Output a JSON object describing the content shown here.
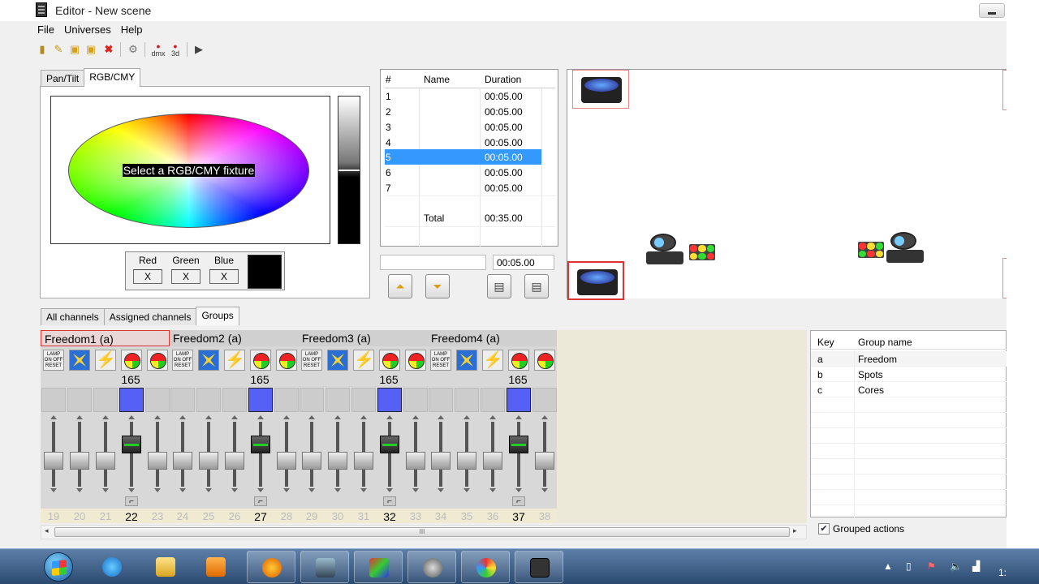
{
  "window": {
    "title": "Editor - New scene"
  },
  "menu": [
    "File",
    "Universes",
    "Help"
  ],
  "toolbar": {
    "dmx_label": "dmx",
    "threed_label": "3d"
  },
  "color_panel": {
    "tabs": [
      "Pan/Tilt",
      "RGB/CMY"
    ],
    "active_tab": "RGB/CMY",
    "wheel_message": "Select a RGB/CMY fixture",
    "rgb": {
      "labels": [
        "Red",
        "Green",
        "Blue"
      ],
      "values": [
        "X",
        "X",
        "X"
      ],
      "swatch_color": "#000000"
    }
  },
  "steps_table": {
    "headers": [
      "#",
      "Name",
      "Duration"
    ],
    "rows": [
      {
        "num": "1",
        "name": "",
        "duration": "00:05.00"
      },
      {
        "num": "2",
        "name": "",
        "duration": "00:05.00"
      },
      {
        "num": "3",
        "name": "",
        "duration": "00:05.00"
      },
      {
        "num": "4",
        "name": "",
        "duration": "00:05.00"
      },
      {
        "num": "5",
        "name": "",
        "duration": "00:05.00",
        "selected": true
      },
      {
        "num": "6",
        "name": "",
        "duration": "00:05.00"
      },
      {
        "num": "7",
        "name": "",
        "duration": "00:05.00"
      }
    ],
    "total_label": "Total",
    "total_value": "00:35.00",
    "name_input": "",
    "duration_input": "00:05.00"
  },
  "lower_tabs": [
    "All channels",
    "Assigned channels",
    "Groups"
  ],
  "active_lower_tab": "Groups",
  "fixtures": [
    {
      "name": "Freedom1 (a)",
      "value": "165",
      "channels": [
        "19",
        "20",
        "21",
        "22",
        "23"
      ],
      "active": "22",
      "selected": true
    },
    {
      "name": "Freedom2 (a)",
      "value": "165",
      "channels": [
        "24",
        "25",
        "26",
        "27",
        "28"
      ],
      "active": "27"
    },
    {
      "name": "Freedom3 (a)",
      "value": "165",
      "channels": [
        "29",
        "30",
        "31",
        "32",
        "33"
      ],
      "active": "32"
    },
    {
      "name": "Freedom4 (a)",
      "value": "165",
      "channels": [
        "34",
        "35",
        "36",
        "37",
        "38"
      ],
      "active": "37"
    }
  ],
  "lamp_icon_text": "LAMP ON OFF RESET",
  "scroll_grip": "III",
  "groups": {
    "headers": [
      "Key",
      "Group name"
    ],
    "rows": [
      {
        "key": "a",
        "name": "Freedom"
      },
      {
        "key": "b",
        "name": "Spots"
      },
      {
        "key": "c",
        "name": "Cores"
      }
    ],
    "grouped_actions_label": "Grouped actions",
    "grouped_actions_checked": true
  },
  "taskbar": {
    "apps": [
      "internet-explorer",
      "file-explorer",
      "media-player",
      "firefox",
      "video-editor",
      "display",
      "dmx-controller",
      "paint",
      "editor"
    ],
    "clock_partial": "1:"
  }
}
